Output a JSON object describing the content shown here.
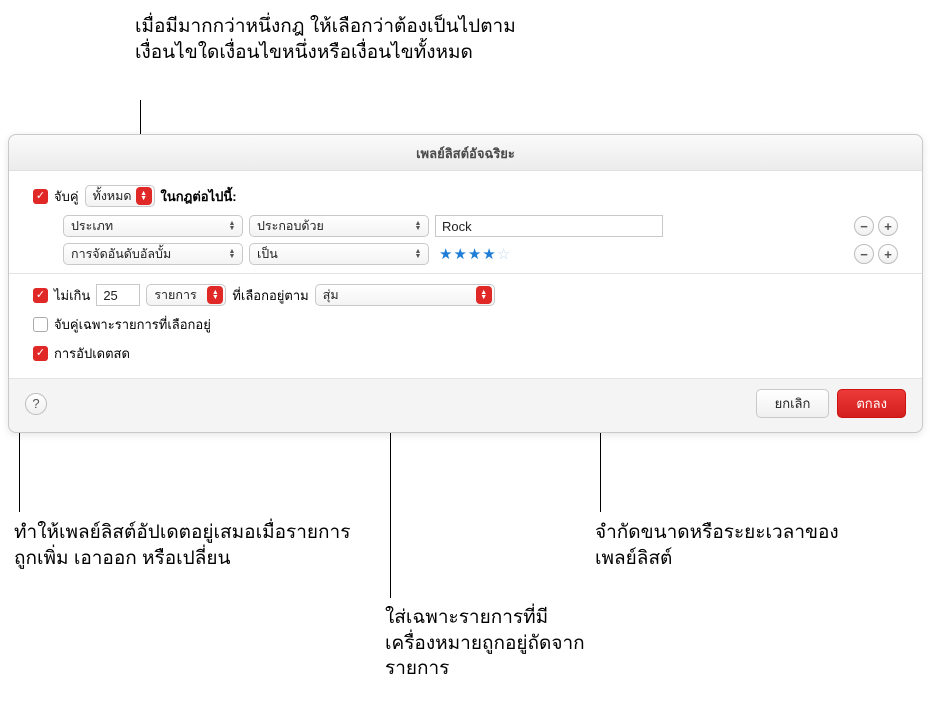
{
  "callouts": {
    "top": "เมื่อมีมากกว่าหนึ่งกฎ ให้เลือกว่าต้องเป็นไปตามเงื่อนไขใดเงื่อนไขหนึ่งหรือเงื่อนไขทั้งหมด",
    "bottom_left": "ทำให้เพลย์ลิสต์อัปเดตอยู่เสมอเมื่อรายการถูกเพิ่ม เอาออก หรือเปลี่ยน",
    "bottom_mid": "ใส่เฉพาะรายการที่มีเครื่องหมายถูกอยู่ถัดจากรายการ",
    "bottom_right": "จำกัดขนาดหรือระยะเวลาของเพลย์ลิสต์"
  },
  "dialog": {
    "title": "เพลย์ลิสต์อัจฉริยะ",
    "match_label_pre": "จับคู่",
    "match_popup": "ทั้งหมด",
    "match_label_post": "ในกฎต่อไปนี้:",
    "rules": [
      {
        "field": "ประเภท",
        "op": "ประกอบด้วย",
        "value": "Rock",
        "type": "text"
      },
      {
        "field": "การจัดอันดับอัลบั้ม",
        "op": "เป็น",
        "value": 4,
        "type": "stars"
      }
    ],
    "limit": {
      "label": "ไม่เกิน",
      "amount": "25",
      "unit": "รายการ",
      "selected_by_label": "ที่เลือกอยู่ตาม",
      "method": "สุ่ม"
    },
    "checked_only": "จับคู่เฉพาะรายการที่เลือกอยู่",
    "live_update": "การอัปเดตสด",
    "cancel": "ยกเลิก",
    "ok": "ตกลง",
    "help": "?"
  },
  "icons": {
    "minus": "−",
    "plus": "+",
    "check": "✓",
    "up": "▲",
    "down": "▼"
  }
}
